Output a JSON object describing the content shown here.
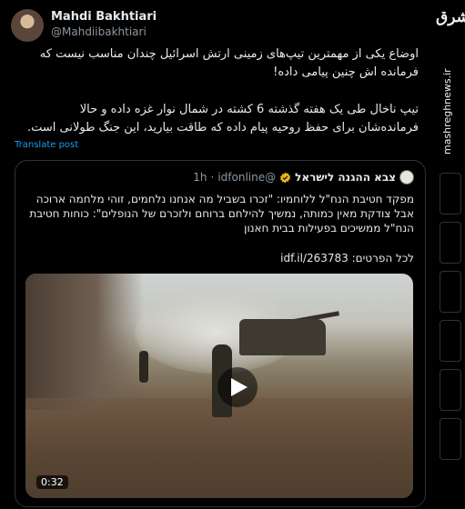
{
  "author": {
    "name": "Mahdi Bakhtiari",
    "handle": "@Mahdiibakhtiari"
  },
  "tweet": {
    "paragraph1": "اوضاع یکی از مهمترین تیپ‌های زمینی ارتش اسرائیل چندان مناسب نیست که فرمانده اش چنین پیامی داده!",
    "paragraph2": "تیپ ناخال طی یک هفته گذشته 6 کشته در شمال نوار غزه داده و حالا فرمانده‌شان برای حفظ روحیه پیام داده که طاقت بیارید، این جنگ طولانی است.",
    "translate_label": "Translate post"
  },
  "quoted": {
    "name": "צבא ההגנה לישראל",
    "handle": "@idfonline",
    "dot": "·",
    "time": "1h",
    "text": "מפקד חטיבת הנח\"ל ללוחמיו: \"זכרו בשביל מה אנחנו נלחמים, זוהי מלחמה ארוכה אבל צודקת מאין כמותה, נמשיך להילחם ברוחם ולזכרם של הנופלים\": כוחות חטיבת הנח\"ל ממשיכים בפעילות בבית חאנון",
    "link_prefix": "לכל הפרטים:",
    "link": "idf.il/263783",
    "video_duration": "0:32"
  },
  "watermark": {
    "logo_text": "مشرق",
    "url": "mashreghnews.ir"
  },
  "colors": {
    "background": "#000000",
    "text": "#e7e9ea",
    "secondary": "#8b98a5",
    "link": "#1d9bf0",
    "border": "#2f3336",
    "verified_gold": "#e2b719"
  }
}
